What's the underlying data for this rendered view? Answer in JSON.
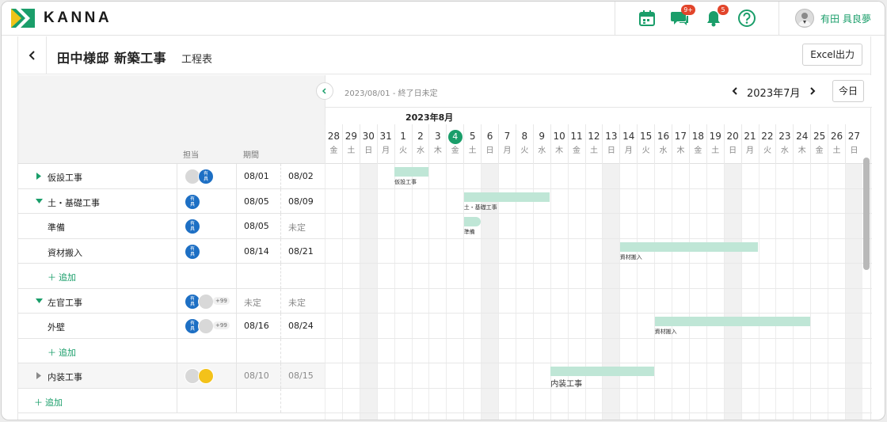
{
  "app": {
    "logo_text": "KANNA",
    "brand_color": "#1a9e6a",
    "header": {
      "chat_badge": "9+",
      "notification_badge": "5",
      "user_name": "有田 具良夢"
    }
  },
  "page": {
    "title": "田中様邸 新築工事",
    "subtitle": "工程表",
    "excel_button": "Excel出力"
  },
  "table": {
    "columns": {
      "assignee": "担当",
      "period": "期間"
    },
    "rows": [
      {
        "name": "仮設工事",
        "start": "08/01",
        "end": "08/02"
      },
      {
        "name": "土・基礎工事",
        "start": "08/05",
        "end": "08/09"
      },
      {
        "name": "準備",
        "start": "08/05",
        "end": "未定"
      },
      {
        "name": "資材搬入",
        "start": "08/14",
        "end": "08/21"
      },
      {
        "name": "追加"
      },
      {
        "name": "左官工事",
        "start": "未定",
        "end": "未定",
        "more": "+99"
      },
      {
        "name": "外壁",
        "start": "08/16",
        "end": "08/24",
        "more": "+99"
      },
      {
        "name": "追加"
      },
      {
        "name": "内装工事",
        "start": "08/10",
        "end": "08/15"
      },
      {
        "name": "追加"
      }
    ],
    "avatar_initials": "有\n具"
  },
  "gantt": {
    "range_text": "2023/08/01 - 終了日未定",
    "current_month": "2023年7月",
    "today_button": "今日",
    "month_label": "2023年8月",
    "days": [
      {
        "d": "28",
        "w": "金"
      },
      {
        "d": "29",
        "w": "土"
      },
      {
        "d": "30",
        "w": "日"
      },
      {
        "d": "31",
        "w": "月"
      },
      {
        "d": "1",
        "w": "火"
      },
      {
        "d": "2",
        "w": "水"
      },
      {
        "d": "3",
        "w": "木"
      },
      {
        "d": "4",
        "w": "金"
      },
      {
        "d": "5",
        "w": "土"
      },
      {
        "d": "6",
        "w": "日"
      },
      {
        "d": "7",
        "w": "月"
      },
      {
        "d": "8",
        "w": "火"
      },
      {
        "d": "9",
        "w": "水"
      },
      {
        "d": "10",
        "w": "木"
      },
      {
        "d": "11",
        "w": "金"
      },
      {
        "d": "12",
        "w": "土"
      },
      {
        "d": "13",
        "w": "日"
      },
      {
        "d": "14",
        "w": "月"
      },
      {
        "d": "15",
        "w": "火"
      },
      {
        "d": "16",
        "w": "水"
      },
      {
        "d": "17",
        "w": "木"
      },
      {
        "d": "18",
        "w": "金"
      },
      {
        "d": "19",
        "w": "土"
      },
      {
        "d": "20",
        "w": "日"
      },
      {
        "d": "21",
        "w": "月"
      },
      {
        "d": "22",
        "w": "火"
      },
      {
        "d": "23",
        "w": "水"
      },
      {
        "d": "24",
        "w": "木"
      },
      {
        "d": "25",
        "w": "金"
      },
      {
        "d": "26",
        "w": "土"
      },
      {
        "d": "27",
        "w": "日"
      }
    ],
    "bars": [
      {
        "label": "仮設工事",
        "start": "08/01",
        "end": "08/02"
      },
      {
        "label": "土・基礎工事",
        "start": "08/05",
        "end": "08/09"
      },
      {
        "label": "準備",
        "start": "08/05",
        "end": "08/05"
      },
      {
        "label": "資材搬入",
        "start": "08/14",
        "end": "08/21"
      },
      {
        "label": "資材搬入",
        "start": "08/16",
        "end": "08/24"
      },
      {
        "label": "内装工事",
        "start": "08/10",
        "end": "08/15"
      }
    ]
  }
}
